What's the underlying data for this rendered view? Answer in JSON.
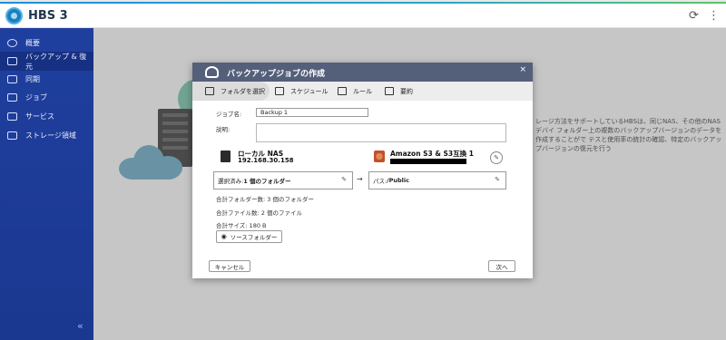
{
  "app": {
    "title": "HBS 3"
  },
  "header": {
    "refresh_icon": "refresh-icon",
    "more_icon": "more-vertical-icon"
  },
  "sidebar": {
    "items": [
      {
        "label": "概要",
        "icon": "overview-icon"
      },
      {
        "label": "バックアップ & 復元",
        "icon": "backup-icon",
        "active": true
      },
      {
        "label": "同期",
        "icon": "sync-icon"
      },
      {
        "label": "ジョブ",
        "icon": "jobs-icon"
      },
      {
        "label": "サービス",
        "icon": "services-icon"
      },
      {
        "label": "ストレージ領域",
        "icon": "storage-icon"
      }
    ],
    "collapse": "«"
  },
  "background_text": "レージ方法をサポートしているHBSは、同じNAS、その他のNASデバイ フォルダー上の複数のバックアップバージョンのデータを作成することがで テスと使用率の統計の確認、特定のバックアップバージョンの復元を行う",
  "dialog": {
    "title": "バックアップジョブの作成",
    "close": "×",
    "tabs": [
      {
        "label": "フォルダを選択",
        "icon": "folder-select-icon",
        "active": true
      },
      {
        "label": "スケジュール",
        "icon": "calendar-icon"
      },
      {
        "label": "ルール",
        "icon": "rules-icon"
      },
      {
        "label": "要約",
        "icon": "summary-icon"
      }
    ],
    "job_name_label": "ジョブ名:",
    "job_name_value": "Backup 1",
    "description_label": "説明:",
    "source": {
      "name": "ローカル NAS",
      "ip": "192.168.30.158"
    },
    "destination": {
      "name": "Amazon S3 & S3互換 1"
    },
    "selected_prefix": "選択済み: ",
    "selected_value": "1 個のフォルダー",
    "arrow": "→",
    "path_prefix": "パス: ",
    "path_value": "/Public",
    "total_folders": "合計フォルダー数: 3 個のフォルダー",
    "total_files": "合計ファイル数: 2 個のファイル",
    "total_size": "合計サイズ: 180 B",
    "source_folder_button": "ソースフォルダー",
    "cancel_button": "キャンセル",
    "next_button": "次へ"
  }
}
